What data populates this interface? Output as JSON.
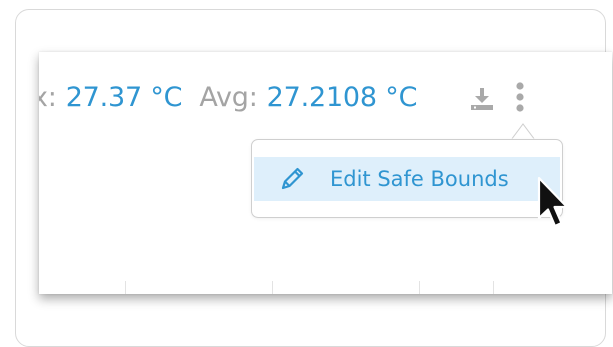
{
  "stats": {
    "max_label_fragment": "x:",
    "max_value": "27.37 °C",
    "avg_label": "Avg:",
    "avg_value": "27.2108 °C"
  },
  "icons": {
    "download": "download-icon",
    "more": "kebab-vertical-icon",
    "edit": "pencil-icon",
    "cursor": "mouse-pointer-icon"
  },
  "menu": {
    "items": [
      {
        "label": "Edit Safe Bounds",
        "icon": "pencil-icon",
        "hovered": true
      }
    ]
  },
  "colors": {
    "accent": "#2f95d1",
    "muted_text": "#a4a4a4",
    "icon_gray": "#a9a9a9",
    "menu_hover_bg": "#deeffb"
  }
}
